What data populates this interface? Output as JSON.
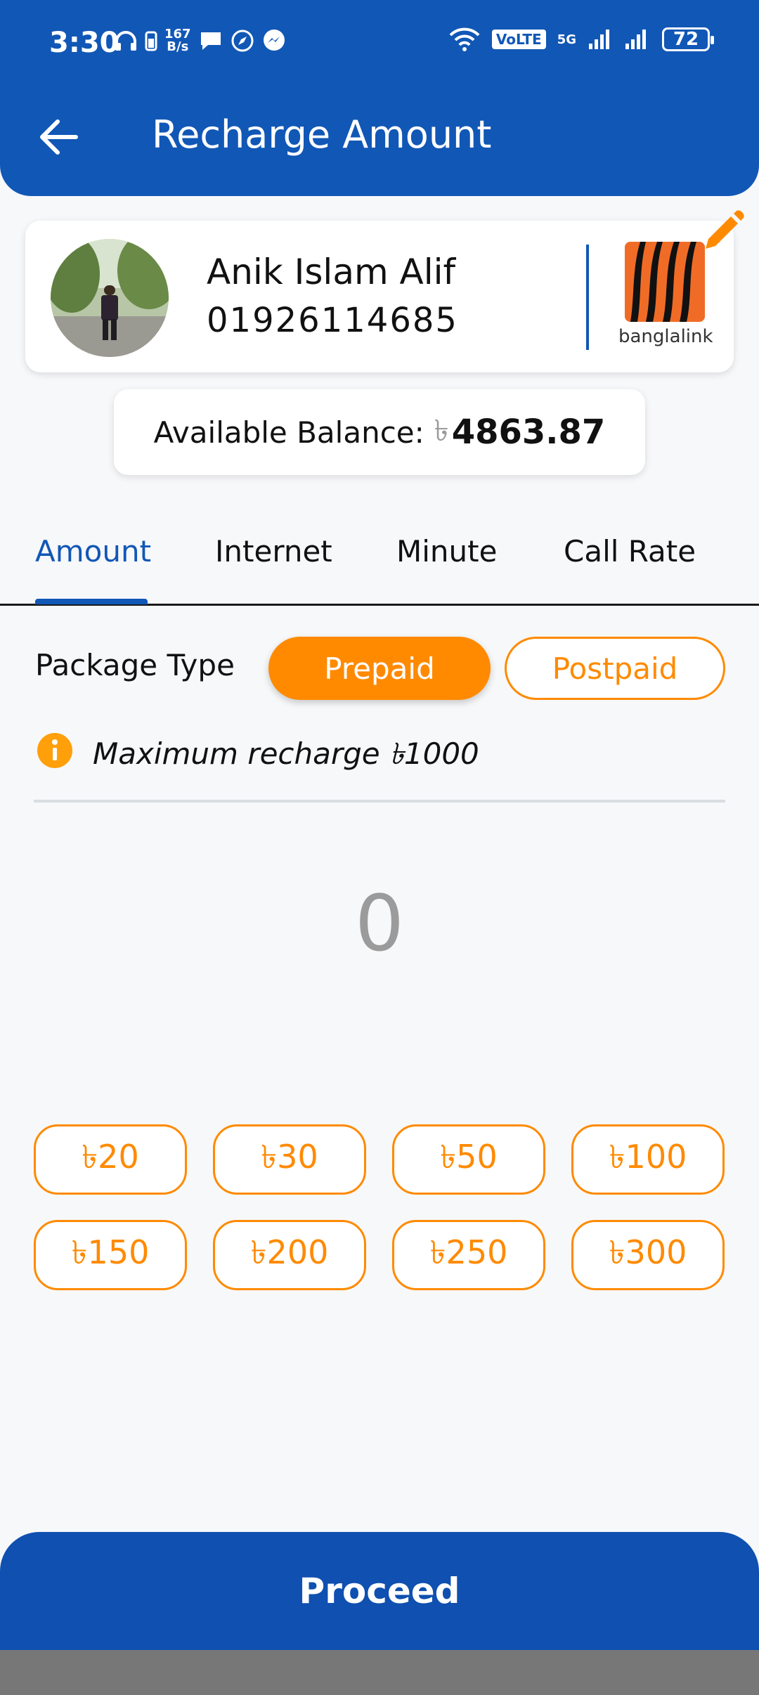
{
  "status_bar": {
    "time": "3:30",
    "net_speed_top": "167",
    "net_speed_bottom": "B/s",
    "volte": "VoLTE",
    "network": "5G",
    "battery": "72"
  },
  "header": {
    "title": "Recharge Amount"
  },
  "contact": {
    "name": "Anik Islam Alif",
    "number": "01926114685",
    "operator": "banglalink"
  },
  "balance": {
    "label": "Available Balance:",
    "currency": "৳",
    "amount": "4863.87"
  },
  "tabs": [
    {
      "label": "Amount",
      "active": true
    },
    {
      "label": "Internet",
      "active": false
    },
    {
      "label": "Minute",
      "active": false
    },
    {
      "label": "Call Rate",
      "active": false
    }
  ],
  "package_type": {
    "label": "Package Type",
    "options": [
      "Prepaid",
      "Postpaid"
    ],
    "selected": "Prepaid"
  },
  "info": {
    "text": "Maximum recharge ৳1000"
  },
  "amount_input": {
    "value": "0"
  },
  "quick_amounts": [
    "৳20",
    "৳30",
    "৳50",
    "৳100",
    "৳150",
    "৳200",
    "৳250",
    "৳300"
  ],
  "proceed": {
    "label": "Proceed"
  },
  "colors": {
    "primary": "#1157b6",
    "accent": "#ff8a00"
  }
}
